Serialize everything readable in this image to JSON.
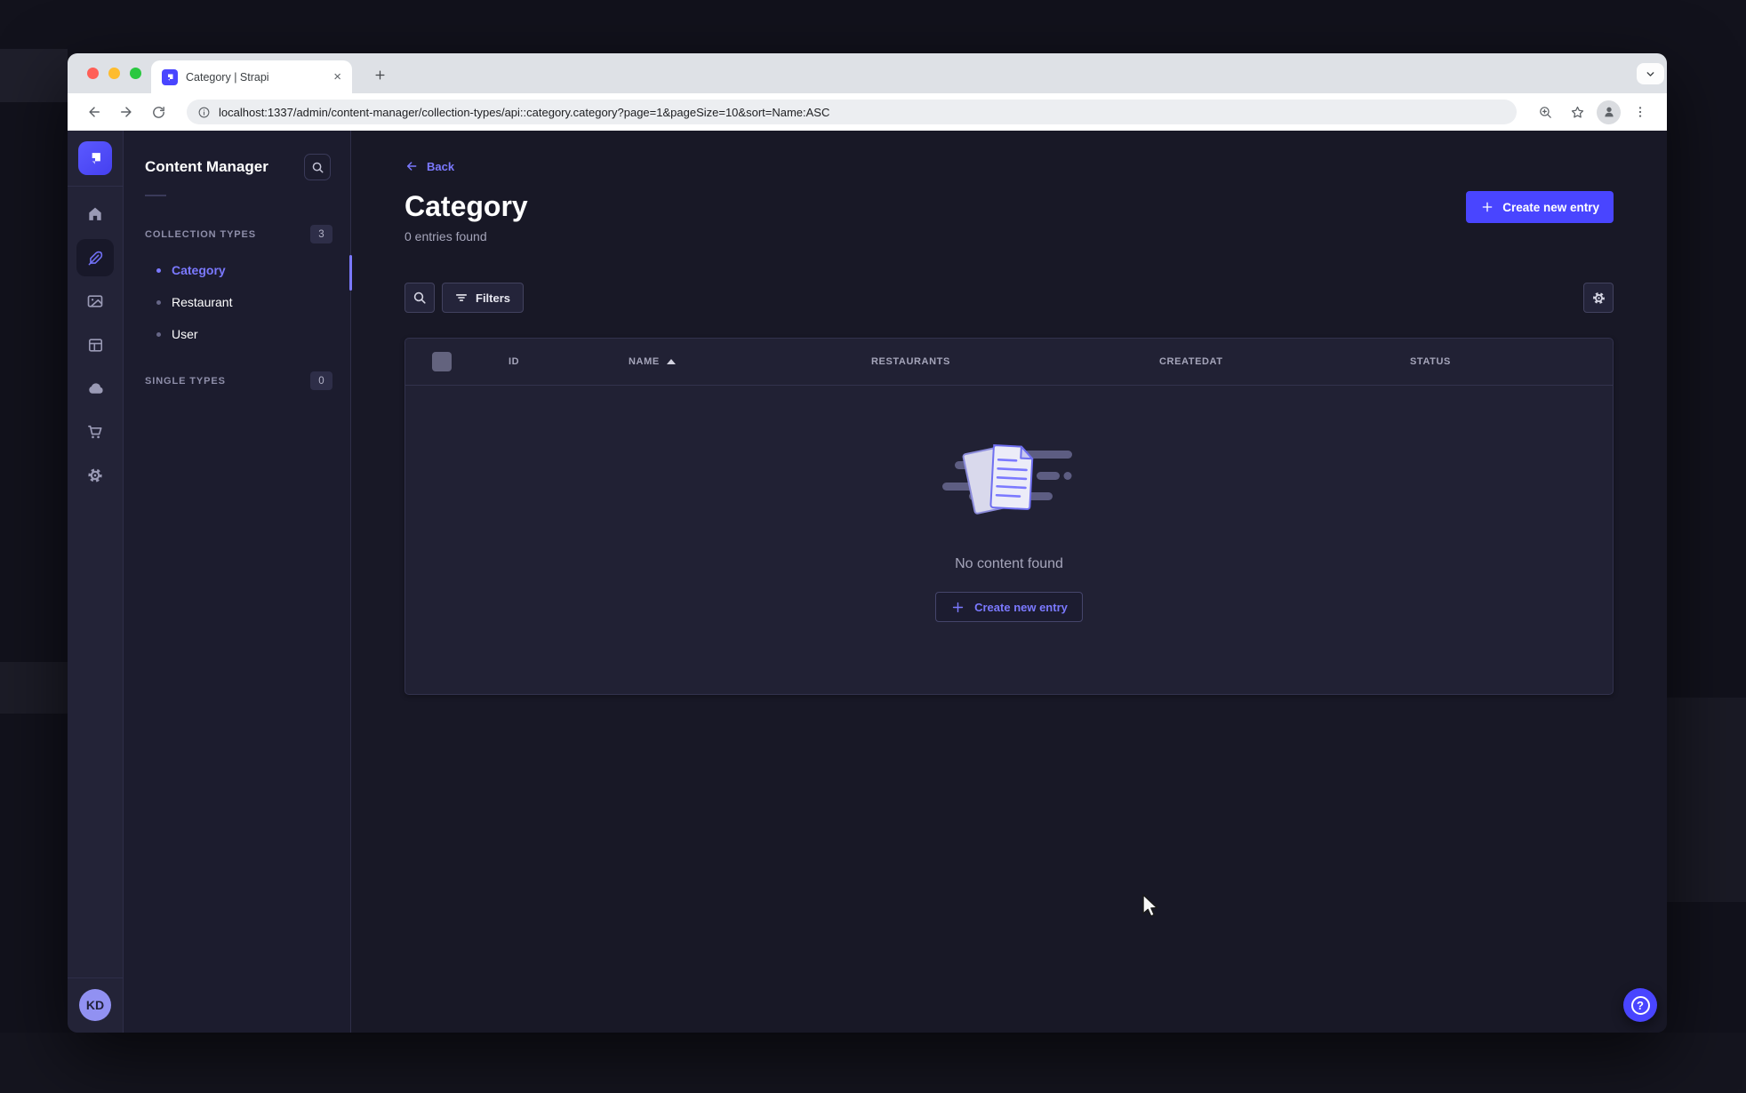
{
  "browser": {
    "tab_title": "Category | Strapi",
    "url": "localhost:1337/admin/content-manager/collection-types/api::category.category?page=1&pageSize=10&sort=Name:ASC"
  },
  "icons": {
    "close": "×",
    "question": "?"
  },
  "sidebar": {
    "avatar_initials": "KD",
    "nav_items": [
      {
        "icon": "home-icon",
        "active": false
      },
      {
        "icon": "content-manager-feather-icon",
        "active": true
      },
      {
        "icon": "media-library-icon",
        "active": false
      },
      {
        "icon": "content-type-builder-icon",
        "active": false
      },
      {
        "icon": "cloud-icon",
        "active": false
      },
      {
        "icon": "marketplace-cart-icon",
        "active": false
      },
      {
        "icon": "settings-gear-icon",
        "active": false
      }
    ]
  },
  "subnav": {
    "title": "Content Manager",
    "sections": [
      {
        "label": "COLLECTION TYPES",
        "badge": "3",
        "items": [
          {
            "label": "Category",
            "active": true
          },
          {
            "label": "Restaurant",
            "active": false
          },
          {
            "label": "User",
            "active": false
          }
        ]
      },
      {
        "label": "SINGLE TYPES",
        "badge": "0",
        "items": []
      }
    ]
  },
  "main": {
    "back_label": "Back",
    "title": "Category",
    "subtitle": "0 entries found",
    "create_button_label": "Create new entry",
    "filters_label": "Filters",
    "table": {
      "columns": [
        "ID",
        "NAME",
        "RESTAURANTS",
        "CREATEDAT",
        "STATUS"
      ],
      "sorted_column": "NAME",
      "sort_direction": "asc",
      "rows": []
    },
    "empty": {
      "message": "No content found",
      "cta_label": "Create new entry"
    }
  },
  "colors": {
    "accent": "#4945ff",
    "accent_light": "#7b79ff",
    "page_background": "#181826",
    "card_background": "#212134",
    "avatar_background": "#9191f2"
  }
}
